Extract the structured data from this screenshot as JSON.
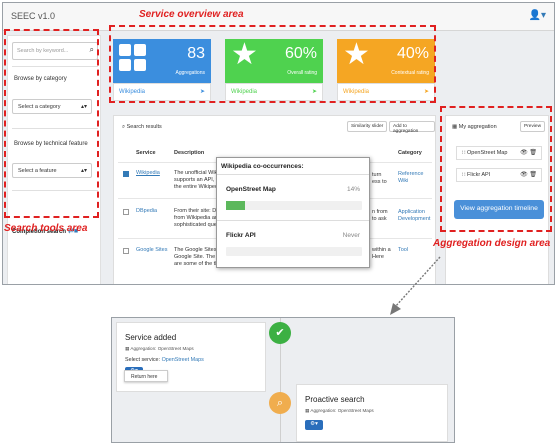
{
  "app": {
    "title": "SEEC v1.0",
    "user_icon": "user-icon"
  },
  "annotations": {
    "overview": "Service overview area",
    "search_tools": "Search tools area",
    "aggregation": "Aggregation design area"
  },
  "sidebar": {
    "search_placeholder": "Search by keyword...",
    "browse_category": "Browse by category",
    "category_select": "Select a category",
    "browse_feature": "Browse by technical feature",
    "feature_select": "Select a feature",
    "completion": "Completion search"
  },
  "tiles": [
    {
      "value": "83",
      "caption": "Aggregations",
      "link": "Wikipedia",
      "color": "#3b8ede",
      "icon": "grid-icon"
    },
    {
      "value": "60%",
      "caption": "Overall rating",
      "link": "Wikipedia",
      "color": "#4fd24f",
      "icon": "star-icon"
    },
    {
      "value": "40%",
      "caption": "Contextual rating",
      "link": "Wikipedia",
      "color": "#f5a623",
      "icon": "star-icon"
    }
  ],
  "results": {
    "title": "Search results",
    "similarity_btn": "Similarity slider",
    "add_btn": "Add to aggregation",
    "headers": {
      "service": "Service",
      "description": "Description",
      "category": "Category"
    },
    "rows": [
      {
        "service": "Wikipedia",
        "desc1": "The unofficial Wik",
        "desc2": "supports an API, w",
        "desc3": "the entire Wikiped",
        "right1": "turn",
        "right2": "ess to",
        "cat1": "Reference",
        "cat2": "Wiki",
        "checked": true
      },
      {
        "service": "DBpedia",
        "desc1": "From their site: DB",
        "desc2": "from Wikipedia and to",
        "desc3": "sophisticated quer",
        "right1": "n from",
        "right2": "to ask",
        "cat1": "Application",
        "cat2": "Development",
        "checked": false
      },
      {
        "service": "Google Sites",
        "desc1": "The Google Sites",
        "desc2": "Google Site. The A",
        "desc3": "are some of the things you...",
        "right1": "within a",
        "right2": "Here",
        "cat1": "Tool",
        "cat2": "",
        "checked": false
      }
    ]
  },
  "popup": {
    "title": "Wikipedia co-occurrences:",
    "items": [
      {
        "name": "OpenStreet Map",
        "pct": "14%",
        "fill": 14
      },
      {
        "name": "Flickr API",
        "pct": "Never",
        "fill": 0
      }
    ]
  },
  "aggregation": {
    "title": "My aggregation",
    "preview": "Preview",
    "items": [
      "OpenStreet Map",
      "Flickr API"
    ],
    "view_btn": "View aggregation timeline"
  },
  "timeline": {
    "card1": {
      "title": "Service added",
      "meta": "Aggregation: OpenStreet Maps",
      "line_label": "Select service:",
      "line_value": "OpenStreet Maps",
      "menu": "Return here"
    },
    "card2": {
      "title": "Proactive search",
      "meta": "Aggregation: OpenStreet Maps"
    }
  }
}
